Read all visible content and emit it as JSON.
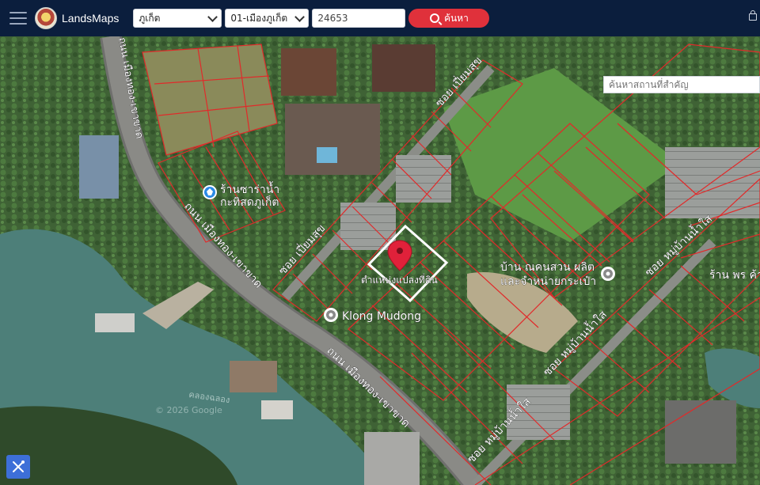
{
  "header": {
    "brand": "LandsMaps",
    "province": "ภูเก็ต",
    "district": "01-เมืองภูเก็ต",
    "parcel_no": "24653",
    "search_label": "ค้นหา"
  },
  "map": {
    "place_search_placeholder": "ค้นหาสถานที่สำคัญ",
    "labels": {
      "road_main_north": "ถนน เมืองทอง-เขาขาด",
      "road_main_mid": "ถนน เมืองทอง-เขาขาด",
      "road_main_south": "ถนน เมืองทอง-เขาขาด",
      "soi_upper": "ซอย เปี่ยมสุข",
      "soi_lower": "ซอย เปี่ยมสุข",
      "soi_moo_upper": "ซอย หมู่บ้านน้ำใส",
      "soi_moo_mid": "ซอย หมู่บ้านน้ำใส",
      "soi_moo_lower": "ซอย หมู่บ้านน้ำใส",
      "shop_line1": "ร้านซาร่าน้ำ",
      "shop_line2": "กะทิสดภูเก็ต",
      "parcel_location": "ตำแหน่งแปลงที่ดิน",
      "klong_mudong": "Klong Mudong",
      "house_line1": "บ้าน ณคนสวน ผลิต",
      "house_line2": "และจำหน่ายกระเป๋า",
      "right_shop": "ร้าน พร ค้า",
      "canal": "คลองฉลอง",
      "copyright": "© 2026 Google"
    }
  },
  "colors": {
    "topbar": "#0b1e3d",
    "search_button": "#e0313b",
    "parcel_lines": "#e12a2a",
    "tool_button": "#3d6fd8"
  }
}
